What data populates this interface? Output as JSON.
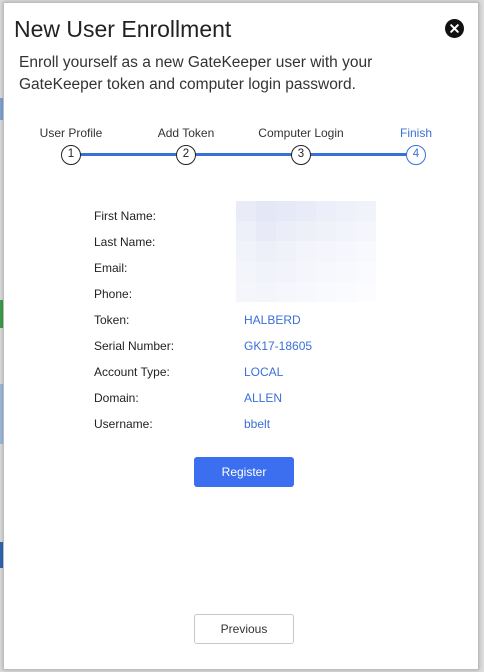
{
  "dialog": {
    "title": "New User Enrollment",
    "subtitle": "Enroll yourself as a new GateKeeper user with your GateKeeper token and computer login password.",
    "close_icon": "close-circle-icon"
  },
  "steps": [
    {
      "label": "User Profile",
      "number": "1",
      "active": false
    },
    {
      "label": "Add Token",
      "number": "2",
      "active": false
    },
    {
      "label": "Computer Login",
      "number": "3",
      "active": false
    },
    {
      "label": "Finish",
      "number": "4",
      "active": true
    }
  ],
  "summary": {
    "first_name_label": "First Name:",
    "last_name_label": "Last Name:",
    "email_label": "Email:",
    "phone_label": "Phone:",
    "token_label": "Token:",
    "token_value": "HALBERD",
    "serial_label": "Serial Number:",
    "serial_value": "GK17-18605",
    "account_type_label": "Account Type:",
    "account_type_value": "LOCAL",
    "domain_label": "Domain:",
    "domain_value": "ALLEN",
    "username_label": "Username:",
    "username_value": "bbelt"
  },
  "buttons": {
    "register": "Register",
    "previous": "Previous"
  },
  "colors": {
    "accent": "#3a6fd8",
    "button_primary": "#3b6ff0"
  }
}
